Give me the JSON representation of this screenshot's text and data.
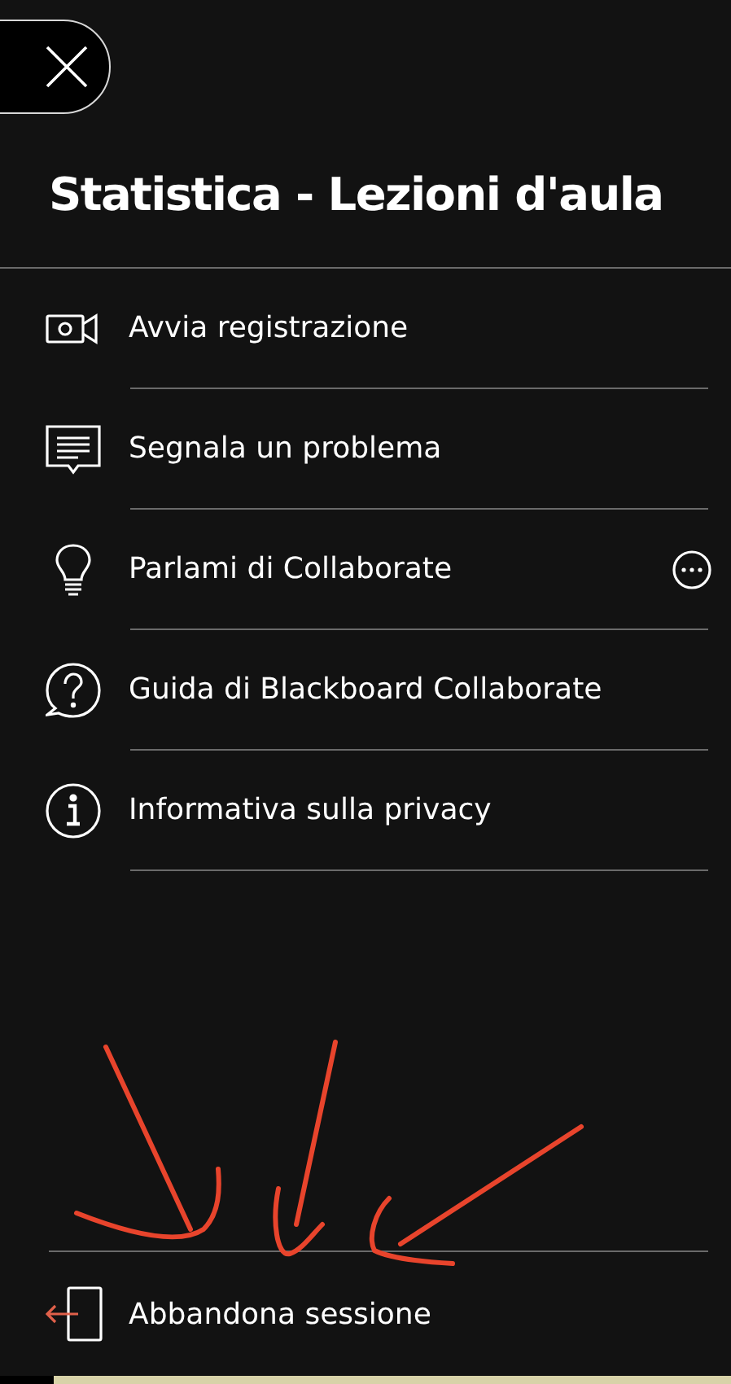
{
  "title": "Statistica - Lezioni d'aula",
  "menu_items": [
    {
      "kind": "camera",
      "label": "Avvia registrazione"
    },
    {
      "kind": "feedback",
      "label": "Segnala un problema"
    },
    {
      "kind": "bulb",
      "label": "Parlami di Collaborate",
      "more": true
    },
    {
      "kind": "help",
      "label": "Guida di Blackboard Collaborate"
    },
    {
      "kind": "info",
      "label": "Informativa sulla privacy"
    }
  ],
  "leave": {
    "label": "Abbandona sessione"
  }
}
